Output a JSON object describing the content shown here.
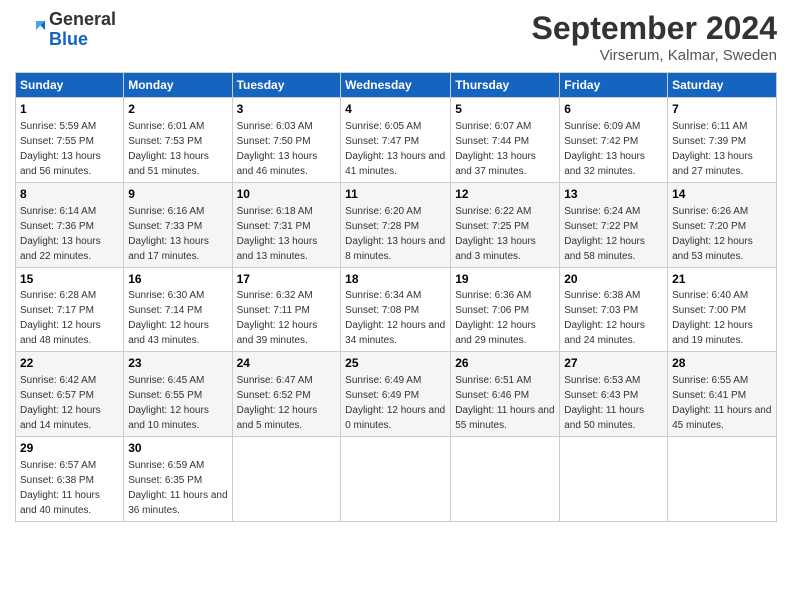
{
  "header": {
    "logo_general": "General",
    "logo_blue": "Blue",
    "month_title": "September 2024",
    "subtitle": "Virserum, Kalmar, Sweden"
  },
  "days_of_week": [
    "Sunday",
    "Monday",
    "Tuesday",
    "Wednesday",
    "Thursday",
    "Friday",
    "Saturday"
  ],
  "weeks": [
    [
      {
        "day": "1",
        "sunrise": "5:59 AM",
        "sunset": "7:55 PM",
        "daylight": "13 hours and 56 minutes."
      },
      {
        "day": "2",
        "sunrise": "6:01 AM",
        "sunset": "7:53 PM",
        "daylight": "13 hours and 51 minutes."
      },
      {
        "day": "3",
        "sunrise": "6:03 AM",
        "sunset": "7:50 PM",
        "daylight": "13 hours and 46 minutes."
      },
      {
        "day": "4",
        "sunrise": "6:05 AM",
        "sunset": "7:47 PM",
        "daylight": "13 hours and 41 minutes."
      },
      {
        "day": "5",
        "sunrise": "6:07 AM",
        "sunset": "7:44 PM",
        "daylight": "13 hours and 37 minutes."
      },
      {
        "day": "6",
        "sunrise": "6:09 AM",
        "sunset": "7:42 PM",
        "daylight": "13 hours and 32 minutes."
      },
      {
        "day": "7",
        "sunrise": "6:11 AM",
        "sunset": "7:39 PM",
        "daylight": "13 hours and 27 minutes."
      }
    ],
    [
      {
        "day": "8",
        "sunrise": "6:14 AM",
        "sunset": "7:36 PM",
        "daylight": "13 hours and 22 minutes."
      },
      {
        "day": "9",
        "sunrise": "6:16 AM",
        "sunset": "7:33 PM",
        "daylight": "13 hours and 17 minutes."
      },
      {
        "day": "10",
        "sunrise": "6:18 AM",
        "sunset": "7:31 PM",
        "daylight": "13 hours and 13 minutes."
      },
      {
        "day": "11",
        "sunrise": "6:20 AM",
        "sunset": "7:28 PM",
        "daylight": "13 hours and 8 minutes."
      },
      {
        "day": "12",
        "sunrise": "6:22 AM",
        "sunset": "7:25 PM",
        "daylight": "13 hours and 3 minutes."
      },
      {
        "day": "13",
        "sunrise": "6:24 AM",
        "sunset": "7:22 PM",
        "daylight": "12 hours and 58 minutes."
      },
      {
        "day": "14",
        "sunrise": "6:26 AM",
        "sunset": "7:20 PM",
        "daylight": "12 hours and 53 minutes."
      }
    ],
    [
      {
        "day": "15",
        "sunrise": "6:28 AM",
        "sunset": "7:17 PM",
        "daylight": "12 hours and 48 minutes."
      },
      {
        "day": "16",
        "sunrise": "6:30 AM",
        "sunset": "7:14 PM",
        "daylight": "12 hours and 43 minutes."
      },
      {
        "day": "17",
        "sunrise": "6:32 AM",
        "sunset": "7:11 PM",
        "daylight": "12 hours and 39 minutes."
      },
      {
        "day": "18",
        "sunrise": "6:34 AM",
        "sunset": "7:08 PM",
        "daylight": "12 hours and 34 minutes."
      },
      {
        "day": "19",
        "sunrise": "6:36 AM",
        "sunset": "7:06 PM",
        "daylight": "12 hours and 29 minutes."
      },
      {
        "day": "20",
        "sunrise": "6:38 AM",
        "sunset": "7:03 PM",
        "daylight": "12 hours and 24 minutes."
      },
      {
        "day": "21",
        "sunrise": "6:40 AM",
        "sunset": "7:00 PM",
        "daylight": "12 hours and 19 minutes."
      }
    ],
    [
      {
        "day": "22",
        "sunrise": "6:42 AM",
        "sunset": "6:57 PM",
        "daylight": "12 hours and 14 minutes."
      },
      {
        "day": "23",
        "sunrise": "6:45 AM",
        "sunset": "6:55 PM",
        "daylight": "12 hours and 10 minutes."
      },
      {
        "day": "24",
        "sunrise": "6:47 AM",
        "sunset": "6:52 PM",
        "daylight": "12 hours and 5 minutes."
      },
      {
        "day": "25",
        "sunrise": "6:49 AM",
        "sunset": "6:49 PM",
        "daylight": "12 hours and 0 minutes."
      },
      {
        "day": "26",
        "sunrise": "6:51 AM",
        "sunset": "6:46 PM",
        "daylight": "11 hours and 55 minutes."
      },
      {
        "day": "27",
        "sunrise": "6:53 AM",
        "sunset": "6:43 PM",
        "daylight": "11 hours and 50 minutes."
      },
      {
        "day": "28",
        "sunrise": "6:55 AM",
        "sunset": "6:41 PM",
        "daylight": "11 hours and 45 minutes."
      }
    ],
    [
      {
        "day": "29",
        "sunrise": "6:57 AM",
        "sunset": "6:38 PM",
        "daylight": "11 hours and 40 minutes."
      },
      {
        "day": "30",
        "sunrise": "6:59 AM",
        "sunset": "6:35 PM",
        "daylight": "11 hours and 36 minutes."
      },
      null,
      null,
      null,
      null,
      null
    ]
  ]
}
